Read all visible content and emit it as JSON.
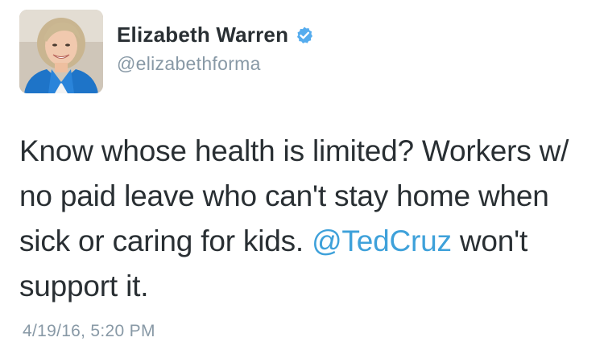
{
  "tweet": {
    "author": {
      "display_name": "Elizabeth Warren",
      "handle": "@elizabethforma",
      "verified": true,
      "avatar_icon": "profile-photo"
    },
    "text_before_mention": "Know whose health is limited? Workers w/ no paid leave who can't stay home when sick or caring for kids. ",
    "mention": "@TedCruz",
    "text_after_mention": " won't support it.",
    "timestamp": "4/19/16, 5:20 PM"
  },
  "colors": {
    "text": "#292f33",
    "secondary": "#8899a6",
    "link": "#3ea1da",
    "verified_badge": "#55acee"
  }
}
